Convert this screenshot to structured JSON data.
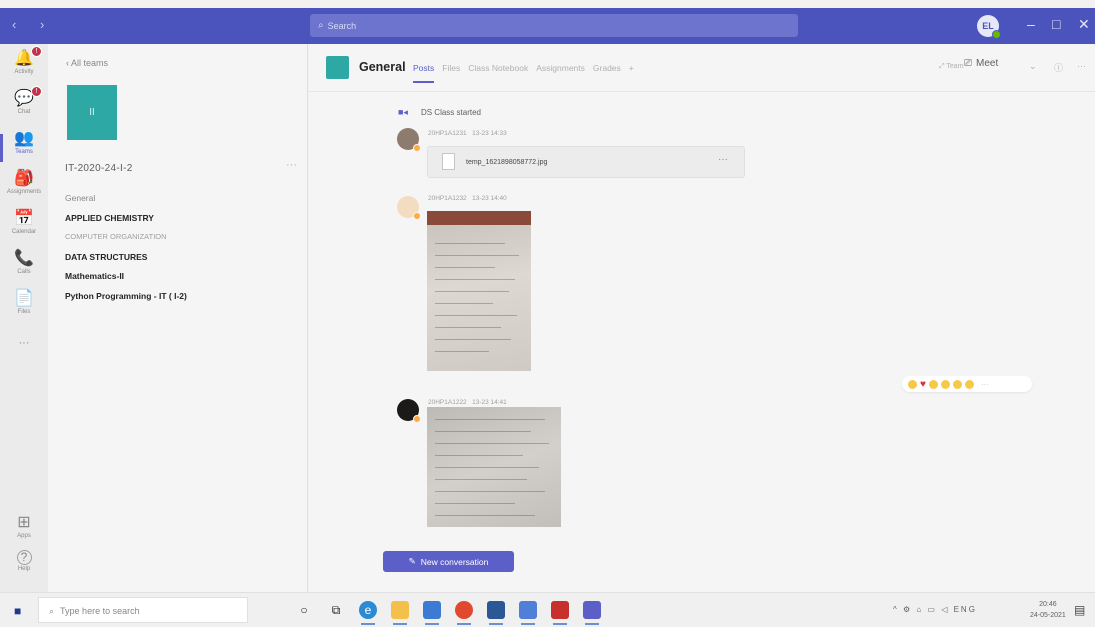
{
  "titlebar": {
    "nav": "‹ ›",
    "search_placeholder": "Search",
    "avatar_initials": "EL",
    "minimize": "–",
    "maximize": "□",
    "close": "✕"
  },
  "rail": {
    "items": [
      {
        "label": "Activity",
        "icon": "bell-icon",
        "glyph": "🔔",
        "badge": "!"
      },
      {
        "label": "Chat",
        "icon": "chat-icon",
        "glyph": "💬",
        "badge": "!"
      },
      {
        "label": "Teams",
        "icon": "teams-icon",
        "glyph": "👥",
        "active": true
      },
      {
        "label": "Assignments",
        "icon": "assignments-icon",
        "glyph": "🎒"
      },
      {
        "label": "Calendar",
        "icon": "calendar-icon",
        "glyph": "📅"
      },
      {
        "label": "Calls",
        "icon": "phone-icon",
        "glyph": "📞"
      },
      {
        "label": "Files",
        "icon": "file-icon",
        "glyph": "📄"
      },
      {
        "label": "",
        "icon": "more-icon",
        "glyph": "···"
      },
      {
        "label": "Apps",
        "icon": "apps-icon",
        "glyph": "⊞"
      },
      {
        "label": "Help",
        "icon": "help-icon",
        "glyph": "?"
      }
    ]
  },
  "team": {
    "back_label": "‹  All teams",
    "tile_text": "II",
    "name": "IT-2020-24-I-2",
    "more": "···",
    "channels": [
      {
        "label": "General",
        "style": "general"
      },
      {
        "label": "APPLIED CHEMISTRY",
        "style": "bold"
      },
      {
        "label": "COMPUTER ORGANIZATION",
        "style": "muted"
      },
      {
        "label": "DATA STRUCTURES",
        "style": "bold"
      },
      {
        "label": "Mathematics-II",
        "style": "bold"
      },
      {
        "label": "Python Programming - IT ( I-2)",
        "style": "python"
      }
    ]
  },
  "header": {
    "title": "General",
    "tabs": [
      "Posts",
      "Files",
      "Class Notebook",
      "Assignments",
      "Grades",
      "+"
    ],
    "team_link": "⤢ Team",
    "meet_label": "Meet",
    "info": "ⓘ",
    "more": "···"
  },
  "feed": {
    "system_message": "DS Class started",
    "posts": [
      {
        "author": "20HP1A1231",
        "time": "13-23 14:33",
        "attachment": "temp_1621898058772.jpg",
        "more": "···"
      },
      {
        "author": "20HP1A1232",
        "time": "13-23 14:40"
      },
      {
        "author": "20HP1A1222",
        "time": "13-23 14:41"
      }
    ],
    "reactions_more": "···",
    "new_conversation": "New conversation"
  },
  "taskbar": {
    "search_placeholder": "Type here to search",
    "tray": "^ ⚙ ⌂ ▭ ◁ ENG",
    "time": "20:46",
    "date": "24-05-2021"
  }
}
